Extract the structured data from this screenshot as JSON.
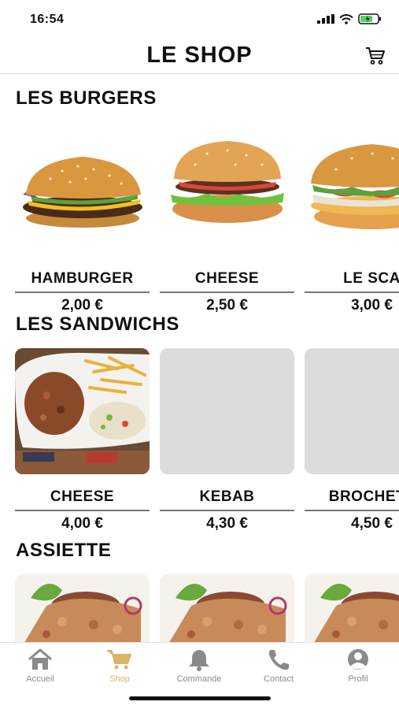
{
  "status": {
    "time": "16:54"
  },
  "header": {
    "title": "LE SHOP"
  },
  "colors": {
    "accent": "#d9b46a",
    "inactive": "#8a8a8a",
    "placeholder": "#dcdcdc"
  },
  "sections": [
    {
      "title": "LES BURGERS",
      "items": [
        {
          "name": "HAMBURGER",
          "price": "2,00 €",
          "image": "hamburger-photo"
        },
        {
          "name": "CHEESE",
          "price": "2,50 €",
          "image": "cheeseburger-photo"
        },
        {
          "name": "LE SCA",
          "price": "3,00 €",
          "image": "chicken-burger-photo"
        }
      ]
    },
    {
      "title": "LES SANDWICHS",
      "items": [
        {
          "name": "CHEESE",
          "price": "4,00 €",
          "image": "kebab-plate-photo"
        },
        {
          "name": "KEBAB",
          "price": "4,30 €",
          "image": "placeholder"
        },
        {
          "name": "BROCHETT",
          "price": "4,50 €",
          "image": "placeholder"
        }
      ]
    },
    {
      "title": "ASSIETTE",
      "items": [
        {
          "image": "assiette-photo"
        },
        {
          "image": "assiette-photo"
        },
        {
          "image": "assiette-photo"
        }
      ]
    }
  ],
  "tabbar": {
    "tabs": [
      {
        "label": "Accueil",
        "icon": "home-icon",
        "active": false
      },
      {
        "label": "Shop",
        "icon": "cart-icon",
        "active": true
      },
      {
        "label": "Commande",
        "icon": "bell-icon",
        "active": false
      },
      {
        "label": "Contact",
        "icon": "phone-icon",
        "active": false
      },
      {
        "label": "Profil",
        "icon": "profile-icon",
        "active": false
      }
    ]
  }
}
